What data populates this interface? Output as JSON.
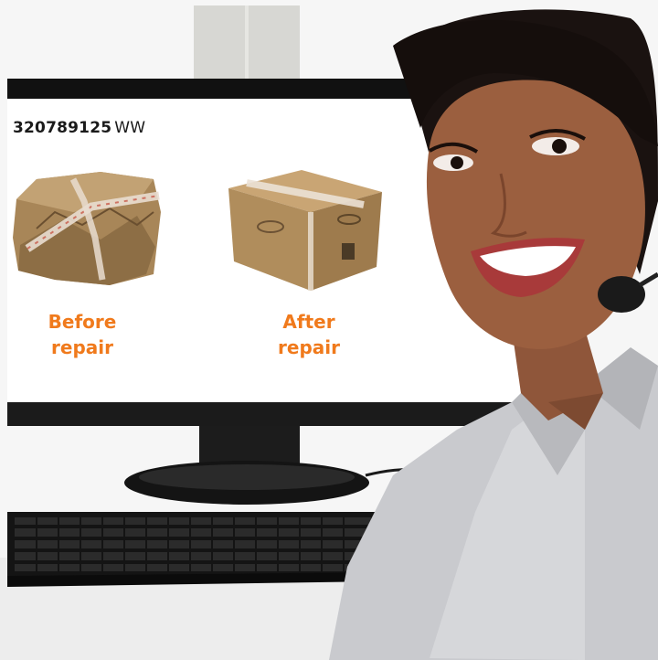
{
  "screen": {
    "tracking_number": "320789125",
    "tracking_suffix": "WW",
    "before_caption": {
      "line1": "Before",
      "line2": "repair"
    },
    "after_caption": {
      "line1": "After",
      "line2": "repair"
    }
  },
  "colors": {
    "caption_orange": "#f07a1c",
    "monitor_frame": "#141414",
    "screen_white": "#ffffff",
    "cardboard": "#b08d5c",
    "blouse": "#c9cace",
    "skin": "#9b5f3f",
    "hair": "#1a1210"
  },
  "icons": {
    "damaged_box": "damaged-box-image",
    "repaired_box": "repaired-box-image",
    "headset": "headset-icon"
  }
}
